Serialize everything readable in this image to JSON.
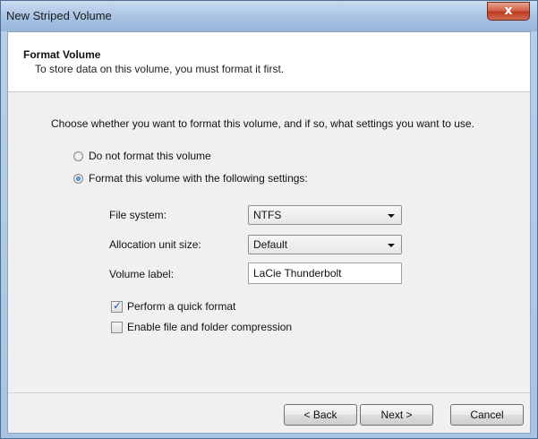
{
  "window": {
    "title": "New Striped Volume",
    "close_glyph": "x"
  },
  "header": {
    "title": "Format Volume",
    "subtitle": "To store data on this volume, you must format it first."
  },
  "instructions": "Choose whether you want to format this volume, and if so, what settings you want to use.",
  "options": {
    "no_format_label": "Do not format this volume",
    "no_format_checked": false,
    "format_label": "Format this volume with the following settings:",
    "format_checked": true
  },
  "settings": {
    "file_system_label": "File system:",
    "file_system_value": "NTFS",
    "allocation_label": "Allocation unit size:",
    "allocation_value": "Default",
    "volume_label_label": "Volume label:",
    "volume_label_value": "LaCie Thunderbolt"
  },
  "checkboxes": {
    "quick_format_label": "Perform a quick format",
    "quick_format_checked": true,
    "compression_label": "Enable file and folder compression",
    "compression_checked": false
  },
  "buttons": {
    "back": "< Back",
    "next": "Next >",
    "cancel": "Cancel"
  }
}
